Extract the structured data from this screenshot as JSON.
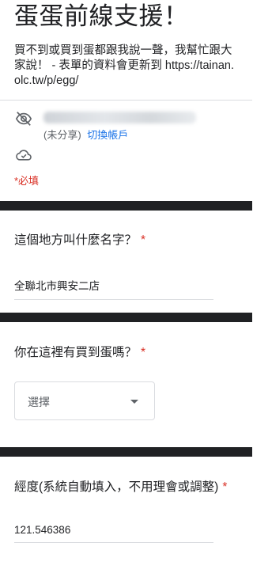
{
  "header": {
    "title": "蛋蛋前線支援！",
    "description": "買不到或買到蛋都跟我說一聲，我幫忙跟大家說！ - 表單的資料會更新到 https://tainan.olc.tw/p/egg/"
  },
  "account": {
    "not_shared": "(未分享)",
    "switch_account": "切換帳戶"
  },
  "required_note": "*必填",
  "questions": [
    {
      "title": "這個地方叫什麼名字？",
      "star": "*",
      "answer": "全聯北市興安二店"
    },
    {
      "title": "你在這裡有買到蛋嗎？",
      "star": "*",
      "select_placeholder": "選擇"
    },
    {
      "title": "經度(系統自動填入，不用理會或調整)",
      "star": "*",
      "answer": "121.546386"
    }
  ],
  "colors": {
    "required": "#d93025",
    "link": "#1a73e8",
    "section_gap": "#202124"
  }
}
